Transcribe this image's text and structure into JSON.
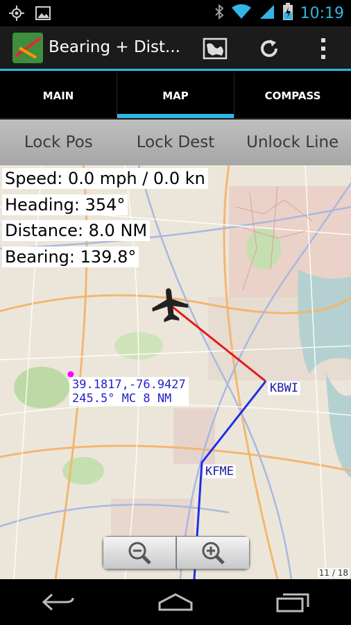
{
  "status_bar": {
    "time": "10:19",
    "left_icons": [
      "gps-icon",
      "image-icon"
    ],
    "right_icons": [
      "bluetooth-icon",
      "wifi-icon",
      "signal-icon",
      "battery-charging-icon"
    ]
  },
  "action_bar": {
    "title": "Bearing + Dist...",
    "icons": [
      "map-icon",
      "refresh-icon",
      "overflow-menu-icon"
    ]
  },
  "tabs": [
    {
      "label": "MAIN",
      "active": false
    },
    {
      "label": "MAP",
      "active": true
    },
    {
      "label": "COMPASS",
      "active": false
    }
  ],
  "lock_buttons": {
    "lock_pos": "Lock Pos",
    "lock_dest": "Lock Dest",
    "unlock_line": "Unlock Line"
  },
  "info": {
    "speed": "Speed: 0.0 mph / 0.0 kn",
    "heading": "Heading: 354°",
    "distance": "Distance: 8.0 NM",
    "bearing": "Bearing: 139.8°"
  },
  "map": {
    "cursor_coords": "39.1817,-76.9427",
    "cursor_bearing": "245.5° MC 8 NM",
    "waypoints": [
      "KBWI",
      "KFME"
    ],
    "page_indicator": "11 / 18",
    "colors": {
      "red_line": "#e31b1b",
      "blue_line": "#1f2ee8",
      "cursor_dot": "#ff00ff",
      "accent": "#33b5e5"
    }
  },
  "nav_bar": {
    "icons": [
      "back-icon",
      "home-icon",
      "recent-apps-icon"
    ]
  }
}
